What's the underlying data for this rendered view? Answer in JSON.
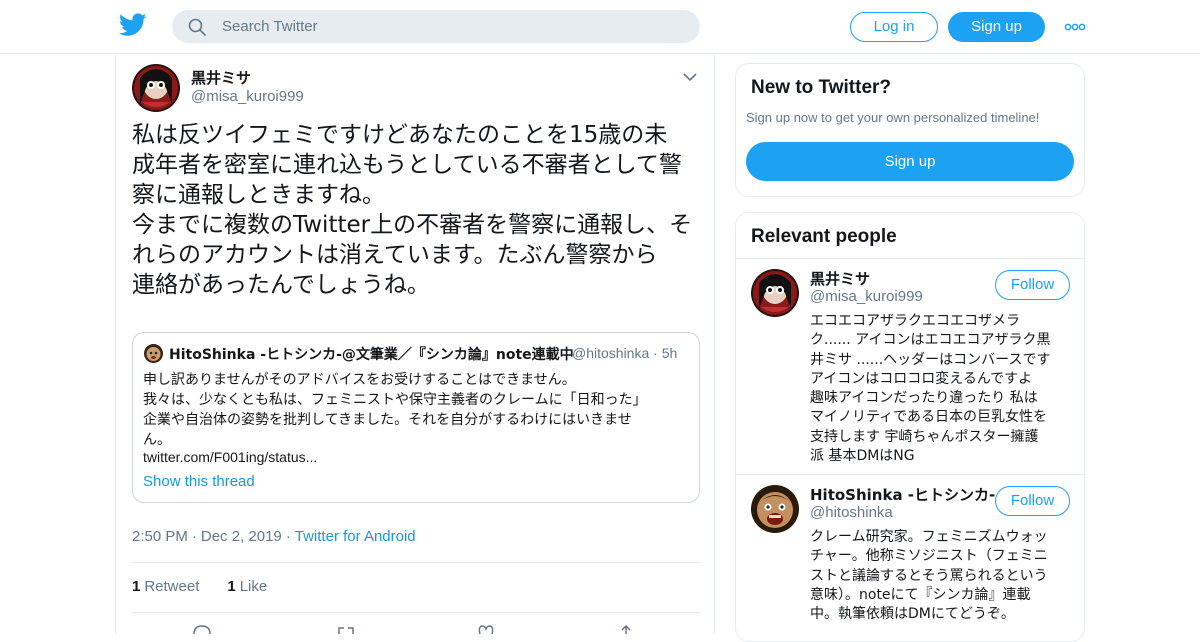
{
  "header": {
    "search_placeholder": "Search Twitter",
    "login_label": "Log in",
    "signup_label": "Sign up",
    "brand_color": "#1da1f2"
  },
  "tweet": {
    "author_name": "黒井ミサ",
    "author_handle": "@misa_kuroi999",
    "text_lines": [
      "私は反ツイフェミですけどあなたのことを15歳の未",
      "成年者を密室に連れ込もうとしている不審者として警",
      "察に通報しときますね。",
      "今までに複数のTwitter上の不審者を警察に通報し、そ",
      "れらのアカウントは消えています。たぶん警察から",
      "連絡があったんでしょうね。"
    ],
    "quoted": {
      "author_name": "HitoShinka -ヒトシンカ-@文筆業／『シンカ論』note連載中",
      "author_handle": "@hitoshinka",
      "time": "5h",
      "text_lines": [
        "申し訳ありませんがそのアドバイスをお受けすることはできません。",
        "我々は、少なくとも私は、フェミニストや保守主義者のクレームに「日和った」",
        "企業や自治体の姿勢を批判してきました。それを自分がするわけにはいきませ",
        "ん。"
      ],
      "link": "twitter.com/F001ing/status...",
      "show_thread": "Show this thread"
    },
    "time": "2:50 PM",
    "date": "Dec 2, 2019",
    "source": "Twitter for Android",
    "retweet_count": "1",
    "retweet_label": "Retweet",
    "like_count": "1",
    "like_label": "Like"
  },
  "sidebar": {
    "new_card": {
      "title": "New to Twitter?",
      "subtitle": "Sign up now to get your own personalized timeline!",
      "signup_label": "Sign up"
    },
    "relevant": {
      "title": "Relevant people",
      "people": [
        {
          "name": "黒井ミサ",
          "handle": "@misa_kuroi999",
          "follow_label": "Follow",
          "bio_lines": [
            "エコエコアザラクエコエコザメラ",
            "ク...... アイコンはエコエコアザラク黒",
            "井ミサ ......ヘッダーはコンバースです",
            "アイコンはコロコロ変えるんですよ",
            "趣味アイコンだったり違ったり 私は",
            "マイノリティである日本の巨乳女性を",
            "支持します 宇崎ちゃんポスター擁護",
            "派 基本DMはNG"
          ]
        },
        {
          "name": "HitoShinka -ヒトシンカ-...",
          "handle": "@hitoshinka",
          "follow_label": "Follow",
          "bio_lines": [
            "クレーム研究家。フェミニズムウォッ",
            "チャー。他称ミソジニスト（フェミニ",
            "ストと議論するとそう罵られるという",
            "意味）。noteにて『シンカ論』連載",
            "中。執筆依頼はDMにてどうぞ。"
          ]
        }
      ]
    }
  }
}
